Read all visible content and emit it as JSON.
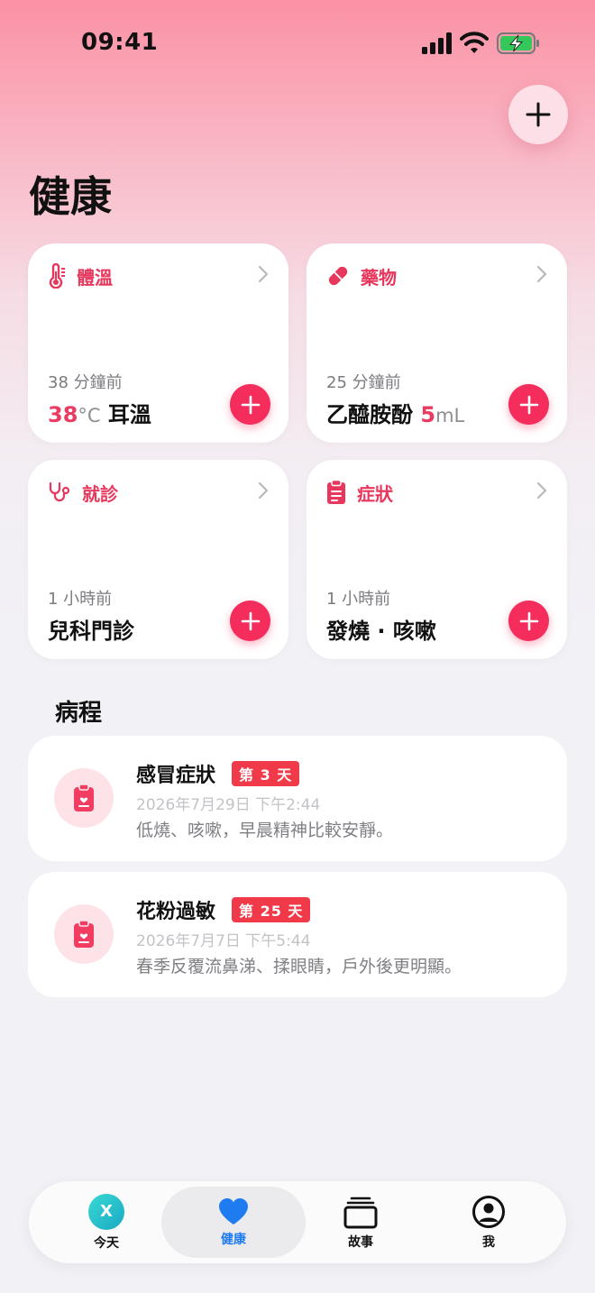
{
  "status_bar": {
    "time": "09:41"
  },
  "page": {
    "title": "健康"
  },
  "cards": [
    {
      "id": "temperature",
      "label": "體溫",
      "ago": "38 分鐘前",
      "value_num": "38",
      "value_unit": "°C",
      "value_text": " 耳溫",
      "icon": "thermometer-icon"
    },
    {
      "id": "medication",
      "label": "藥物",
      "ago": "25 分鐘前",
      "value_text": "乙醯胺酚 ",
      "value_num": "5",
      "value_unit": "mL",
      "icon": "pill-icon"
    },
    {
      "id": "visit",
      "label": "就診",
      "ago": "1 小時前",
      "value_text": "兒科門診",
      "icon": "stethoscope-icon"
    },
    {
      "id": "symptom",
      "label": "症狀",
      "ago": "1 小時前",
      "value_text": "發燒 · 咳嗽",
      "icon": "clipboard-icon"
    }
  ],
  "section": {
    "title": "病程"
  },
  "courses": [
    {
      "title": "感冒症狀",
      "badge": "第 3 天",
      "date": "2026年7月29日 下午2:44",
      "desc": "低燒、咳嗽，早晨精神比較安靜。"
    },
    {
      "title": "花粉過敏",
      "badge": "第 25 天",
      "date": "2026年7月7日 下午5:44",
      "desc": "春季反覆流鼻涕、揉眼睛，戶外後更明顯。"
    }
  ],
  "tabbar": {
    "today": "今天",
    "today_avatar": "X",
    "health": "健康",
    "story": "故事",
    "me": "我"
  },
  "colors": {
    "accent": "#f52d5c",
    "label_red": "#e8375c",
    "tab_active": "#1f7cf0",
    "badge_red": "#f03a4a"
  }
}
